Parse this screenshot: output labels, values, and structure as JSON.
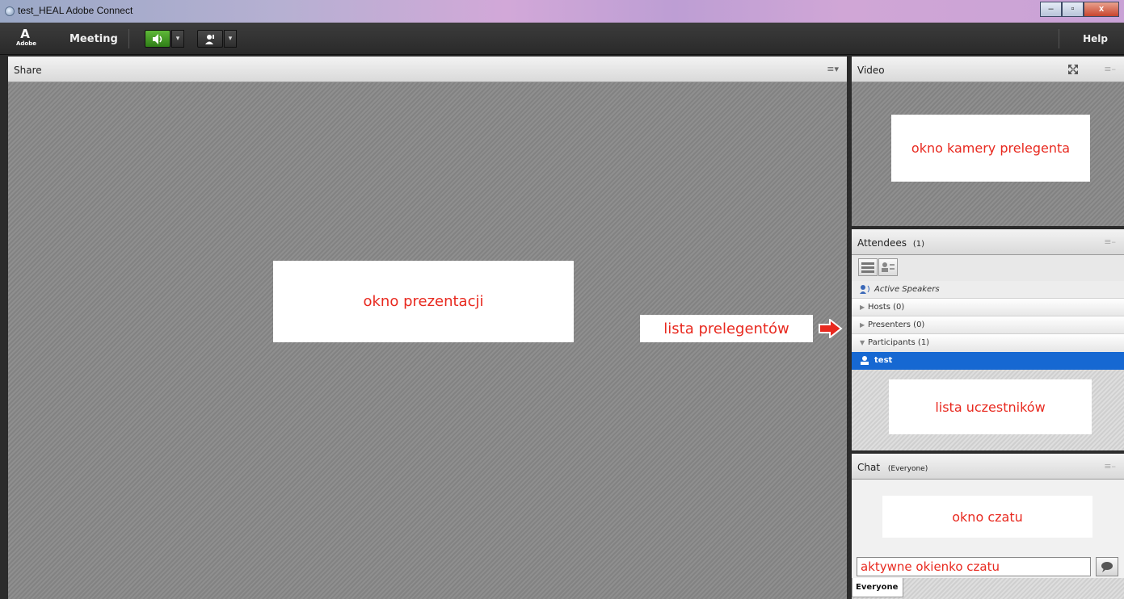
{
  "window": {
    "title": "test_HEAL  Adobe Connect",
    "controls": {
      "minimize": "–",
      "maximize": "▫",
      "close": "x"
    }
  },
  "menubar": {
    "logo_mark": "A",
    "logo_text": "Adobe",
    "meeting_label": "Meeting",
    "help_label": "Help",
    "dropdown_glyph": "▾"
  },
  "share_pod": {
    "title": "Share",
    "menu_glyph": "≡▾",
    "annotation": "okno prezentacji"
  },
  "video_pod": {
    "title": "Video",
    "menu_glyph": "≡–",
    "annotation": "okno kamery prelegenta"
  },
  "attendees_pod": {
    "title": "Attendees",
    "count": "(1)",
    "menu_glyph": "≡–",
    "active_speakers": "Active Speakers",
    "groups": [
      {
        "label": "Hosts (0)",
        "expanded": false
      },
      {
        "label": "Presenters (0)",
        "expanded": false
      },
      {
        "label": "Participants (1)",
        "expanded": true
      }
    ],
    "participants": [
      "test"
    ],
    "annotation_presenters": "lista prelegentów",
    "annotation_participants": "lista uczestników"
  },
  "chat_pod": {
    "title": "Chat",
    "scope": "(Everyone)",
    "menu_glyph": "≡–",
    "annotation": "okno czatu",
    "input_annotation": "aktywne okienko czatu",
    "tab_label": "Everyone"
  },
  "colors": {
    "annotation_text": "#e8291f",
    "selected_row": "#1668d2",
    "audio_button": "#4fa82c"
  }
}
